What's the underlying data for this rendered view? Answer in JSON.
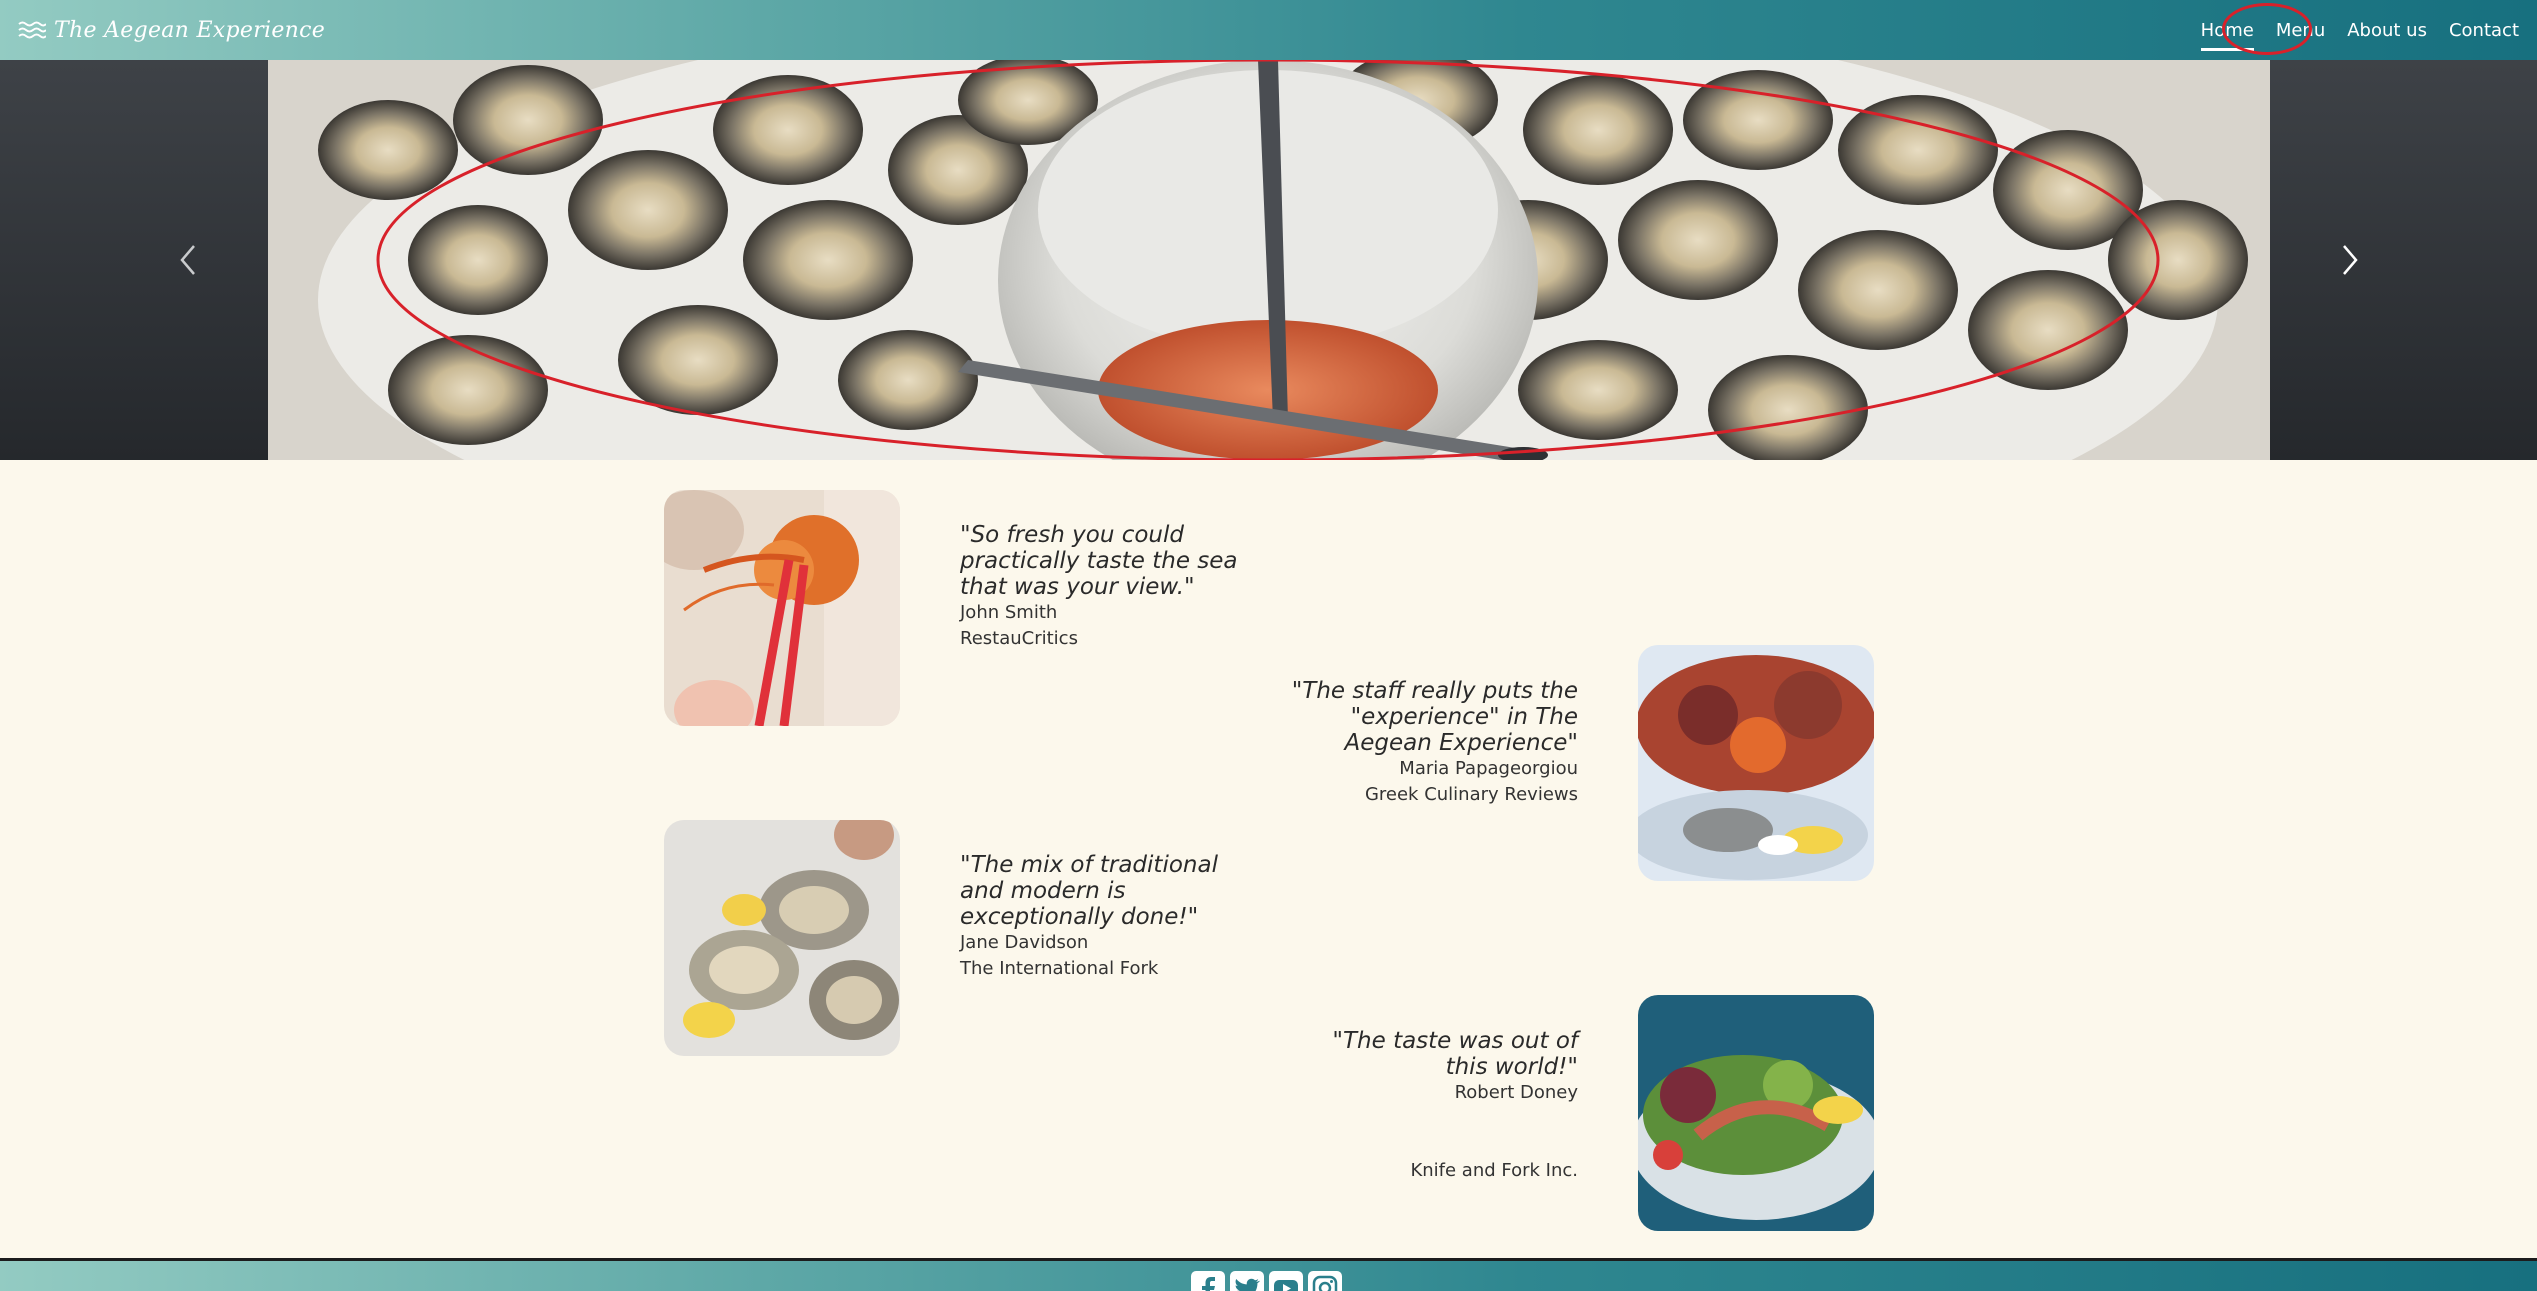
{
  "brand": {
    "name": "The Aegean Experience",
    "icon": "waves-icon"
  },
  "nav": {
    "items": [
      {
        "label": "Home",
        "active": true
      },
      {
        "label": "Menu"
      },
      {
        "label": "About us"
      },
      {
        "label": "Contact"
      }
    ]
  },
  "hero": {
    "prev_icon": "chevron-left-icon",
    "next_icon": "chevron-right-icon"
  },
  "testimonials": [
    {
      "quote": "\"So fresh you could practically taste the sea that was your view.\"",
      "author": "John Smith",
      "source": "RestauCritics",
      "image": "shrimp-photo"
    },
    {
      "quote": "\"The staff really puts the \"experience\" in The Aegean Experience\"",
      "author": "Maria Papageorgiou",
      "source": "Greek Culinary Reviews",
      "image": "seafood-platter-photo"
    },
    {
      "quote": "\"The mix of traditional and modern is exceptionally done!\"",
      "author": "Jane Davidson",
      "source": "The International Fork",
      "image": "oysters-photo"
    },
    {
      "quote": "\"The taste was out of this world!\"",
      "author": "Robert Doney",
      "source": "Knife and Fork Inc.",
      "image": "octopus-salad-photo"
    }
  ],
  "footer": {
    "socials": [
      "facebook-icon",
      "twitter-icon",
      "youtube-icon",
      "instagram-icon"
    ]
  },
  "colors": {
    "nav_start": "#93cbc2",
    "nav_end": "#17707f",
    "background": "#fcf8ec",
    "annotation": "#d8212a"
  }
}
